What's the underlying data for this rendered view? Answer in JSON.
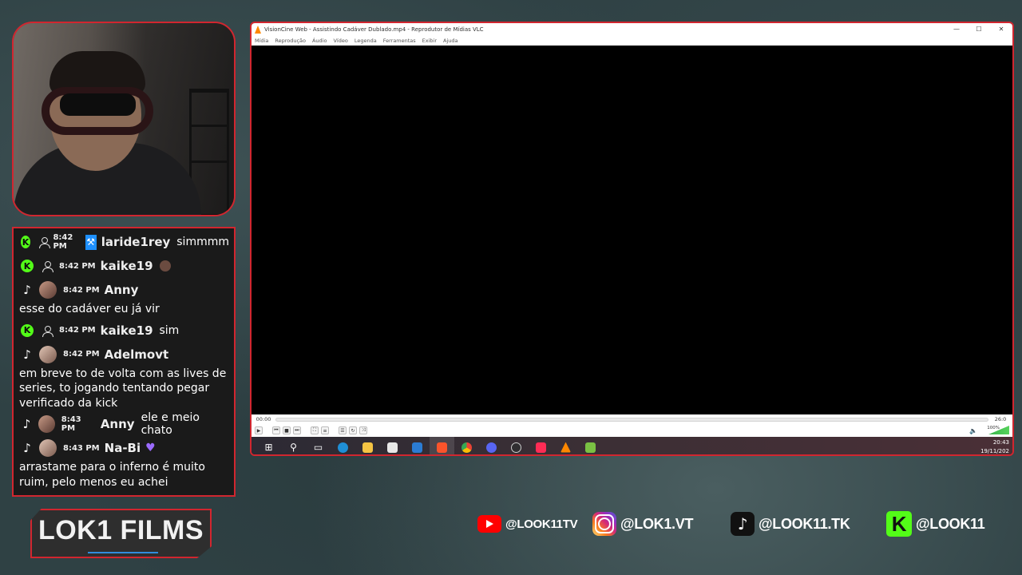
{
  "chat": {
    "messages": [
      {
        "platform": "K",
        "time": "8:42 PM",
        "user": "laride1rey",
        "inline_text": "simmmm",
        "body": ""
      },
      {
        "platform": "K",
        "time": "8:42 PM",
        "user": "kaike19",
        "inline_text": "",
        "body": ""
      },
      {
        "platform": "TikTok",
        "time": "8:42 PM",
        "user": "Anny",
        "inline_text": "",
        "body": "esse do cadáver eu já vir"
      },
      {
        "platform": "K",
        "time": "8:42 PM",
        "user": "kaike19",
        "inline_text": "sim",
        "body": ""
      },
      {
        "platform": "TikTok",
        "time": "8:42 PM",
        "user": "Adelmovt",
        "inline_text": "",
        "body": "em breve to de volta com as lives de series, to jogando tentando pegar verificado da kick"
      },
      {
        "platform": "TikTok",
        "time": "8:43 PM",
        "user": "Anny",
        "inline_text": "ele e meio chato",
        "body": ""
      },
      {
        "platform": "TikTok",
        "time": "8:43 PM",
        "user": "Na-Bi",
        "inline_text": "",
        "body": "arrastame para o inferno é muito ruim, pelo menos eu achei"
      }
    ]
  },
  "logo": {
    "text": "LOK1 FILMS"
  },
  "player": {
    "window_title": "VisionCine Web - Assistindo Cadáver Dublado.mp4 - Reprodutor de Mídias VLC",
    "window_controls": [
      "—",
      "☐",
      "✕"
    ],
    "menu": [
      "Mídia",
      "Reprodução",
      "Áudio",
      "Vídeo",
      "Legenda",
      "Ferramentas",
      "Exibir",
      "Ajuda"
    ],
    "time_elapsed": "00:00",
    "time_total": "26:0",
    "volume_pct": "100%",
    "progress": 0.0,
    "volume_level": 1.0
  },
  "taskbar": {
    "time": "20:43",
    "date": "19/11/202",
    "icons": [
      "windows-icon",
      "search-icon",
      "task-view-icon",
      "edge-icon",
      "file-explorer-icon",
      "store-icon",
      "mail-icon",
      "brave-icon",
      "chrome-icon",
      "discord-icon",
      "obs-icon",
      "tiktok-live-icon",
      "vlc-icon",
      "app-icon"
    ]
  },
  "socials": {
    "youtube": "@LOOK11TV",
    "instagram": "@LOK1.VT",
    "tiktok": "@LOOK11.TK",
    "kick": "@LOOK11"
  },
  "colors": {
    "accent_red": "#d1262f",
    "kick_green": "#53fc18",
    "youtube_red": "#ff0000"
  }
}
